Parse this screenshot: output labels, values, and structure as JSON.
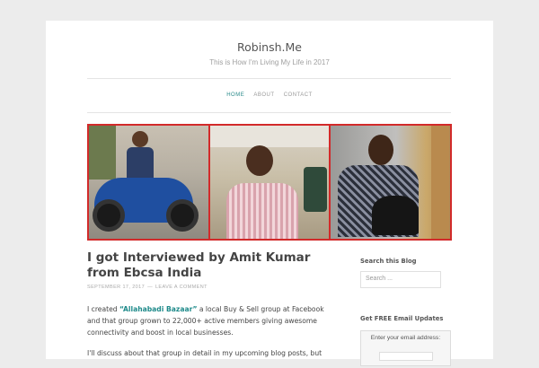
{
  "site": {
    "title": "Robinsh.Me",
    "tagline": "This is How I'm Living My Life in 2017"
  },
  "nav": {
    "items": [
      "HOME",
      "ABOUT",
      "CONTACT"
    ],
    "active": "HOME",
    "accent": "#2a8a8a"
  },
  "banner": {
    "border_color": "#d22a2a"
  },
  "post": {
    "title": "I got Interviewed by Amit Kumar from Ebcsa India",
    "date": "SEPTEMBER 17, 2017",
    "separator": "—",
    "comment_link": "LEAVE A COMMENT",
    "p1_prefix": "I created ",
    "p1_link": "“Allahabadi Bazaar”",
    "p1_suffix": " a local Buy & Sell group at Facebook and that group grown to 22,000+ active members giving awesome connectivity and boost in local businesses.",
    "p2": "I'll discuss about that group in detail in my upcoming blog posts, but"
  },
  "sidebar": {
    "search_title": "Search this Blog",
    "search_placeholder": "Search ...",
    "email_title": "Get FREE Email Updates",
    "email_label": "Enter your email address:"
  }
}
